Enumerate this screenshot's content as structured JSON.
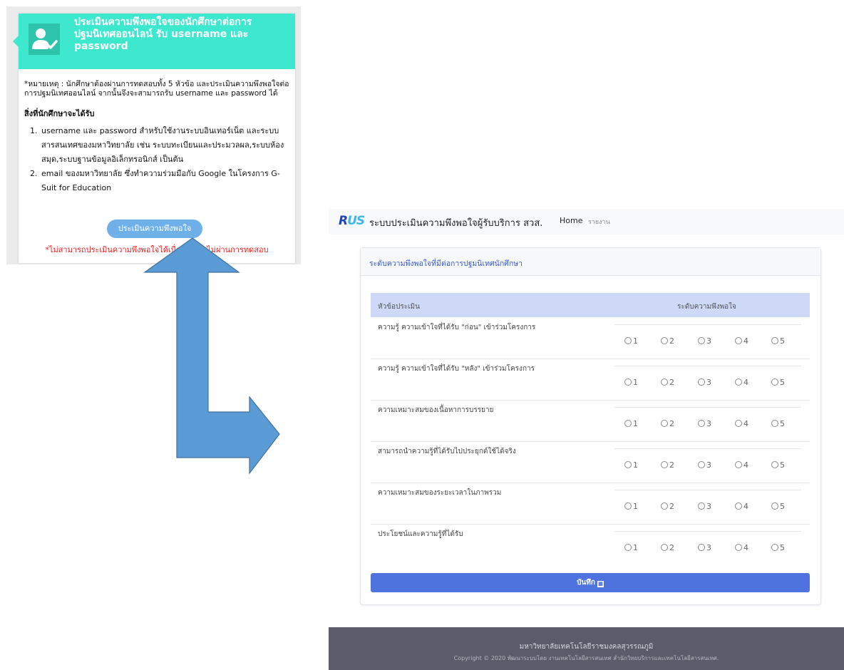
{
  "left_card": {
    "title": "ประเมินความพึงพอใจของนักศึกษาต่อการปฐมนิเทศออนไลน์ รับ username และ password",
    "icon": "user-check-icon",
    "note": "*หมายเหตุ : นักศึกษาต้องผ่านการทดสอบทั้ง 5 หัวข้อ และประเมินความพึงพอใจต่อการปฐมนิเทศออนไลน์ จากนั้นจึงจะสามารถรับ username และ password ได้",
    "benefits_heading": "สิ่งที่นักศึกษาจะได้รับ",
    "benefits": [
      "username และ password สำหรับใช้งานระบบอินเทอร์เน็ต และระบบสารสนเทศของมหาวิทยาลัย เช่น ระบบทะเบียนและประมวลผล,ระบบห้องสมุด,ระบบฐานข้อมูลอิเล็กทรอนิกส์ เป็นต้น",
      "email ของมหาวิทยาลัย ซึ่งทำความร่วมมือกับ Google ในโครงการ G-Suit for Education"
    ],
    "button_label": "ประเมินความพึงพอใจ",
    "warning": "*ไม่สามารถประเมินความพึงพอใจได้เนื่องจากยังไม่ผ่านการทดสอบ",
    "header_color": "#3de8cf"
  },
  "arrow": {
    "color": "#5b9bd5"
  },
  "navbar": {
    "logo_r": "R",
    "logo_us": "US",
    "brand": "ระบบประเมินความพึงพอใจผู้รับบริการ สวส.",
    "home": "Home",
    "report": "รายงาน"
  },
  "panel": {
    "title": "ระดับความพึงพอใจที่มีต่อการปฐมนิเทศนักศึกษา",
    "col_topic": "หัวข้อประเมิน",
    "col_level": "ระดับความพึงพอใจ",
    "options": [
      "1",
      "2",
      "3",
      "4",
      "5"
    ],
    "questions": [
      "ความรู้ ความเข้าใจที่ได้รับ \"ก่อน\" เข้าร่วมโครงการ",
      "ความรู้ ความเข้าใจที่ได้รับ \"หลัง\" เข้าร่วมโครงการ",
      "ความเหมาะสมของเนื้อหาการบรรยาย",
      "สามารถนำความรู้ที่ได้รับไปประยุกต์ใช้ได้จริง",
      "ความเหมาะสมของระยะเวลาในภาพรวม",
      "ประโยชน์และความรู้ที่ได้รับ"
    ],
    "save_label": "บันทึก",
    "accent": "#4e73df"
  },
  "footer": {
    "line1": "มหาวิทยาลัยเทคโนโลยีราชมงคลสุวรรณภูมิ",
    "line2": "Copyright © 2020 พัฒนาระบบโดย งานเทคโนโลยีสารสนเทศ สำนักวิทยบริการและเทคโนโลยีสารสนเทศ."
  }
}
